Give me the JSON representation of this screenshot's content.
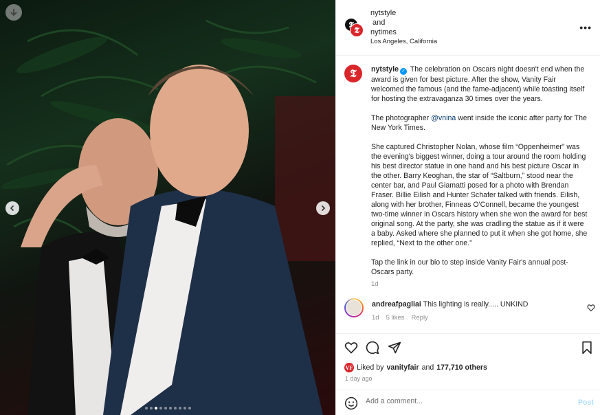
{
  "header": {
    "user1": "nytstyle",
    "joiner": "and",
    "user2": "nytimes",
    "location": "Los Angeles, California",
    "avatar1_glyph": "𝕿",
    "avatar2_glyph": "𝕿"
  },
  "caption": {
    "username": "nytstyle",
    "avatar_glyph": "𝕿",
    "verified_mark": "✓",
    "para1": "The celebration on Oscars night doesn't end when the award is given for best picture. After the show, Vanity Fair welcomed the famous (and the fame-adjacent) while toasting itself for hosting the extravaganza 30 times over the years.",
    "para2_pre": "The photographer ",
    "para2_mention": "@vnina",
    "para2_post": " went inside the iconic after party for The New York Times.",
    "para3": "She captured Christopher Nolan, whose film “Oppenheimer” was the evening's biggest winner, doing a tour around the room holding his best director statue in one hand and his best picture Oscar in the other. Barry Keoghan, the star of “Saltburn,” stood near the center bar, and Paul Giamatti posed for a photo with Brendan Fraser. Billie Eilish and Hunter Schafer talked with friends. Eilish, along with her brother, Finneas O'Connell, became the youngest two-time winner in Oscars history when she won the award for best original song. At the party, she was cradling the statue as if it were a baby. Asked where she planned to put it when she got home, she replied, “Next to the other one.”",
    "para4": "Tap the link in our bio to step inside Vanity Fair's annual post-Oscars party.",
    "time": "1d"
  },
  "comment": {
    "username": "andreafpagliai",
    "text": "This lighting is really..... UNKIND",
    "time": "1d",
    "likes": "5 likes",
    "reply": "Reply"
  },
  "likes": {
    "prefix": "Liked by",
    "user": "vanityfair",
    "joiner": "and",
    "count": "177,710 others",
    "badge": "VF"
  },
  "posted": "1 day ago",
  "add_comment": {
    "placeholder": "Add a comment...",
    "post_label": "Post"
  },
  "carousel": {
    "total_slides": 10,
    "active_index": 2
  },
  "colors": {
    "accent": "#0095f6",
    "nyt_red": "#d9262b"
  }
}
